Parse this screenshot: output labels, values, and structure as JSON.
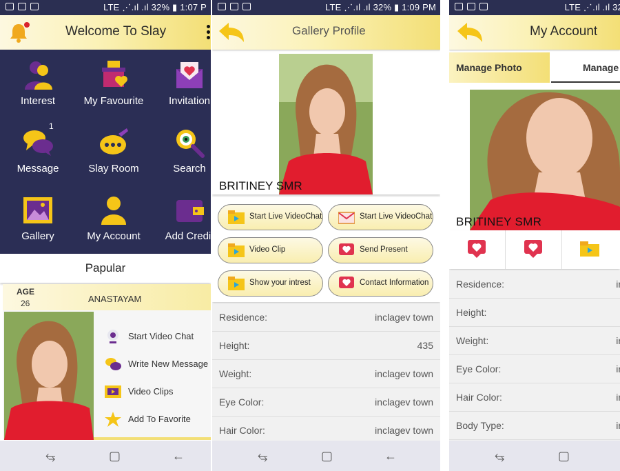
{
  "status": {
    "s1_right": "LTE ⋰.ıl .ıl 32% ▮ 1:07 P",
    "s2_right": "LTE ⋰.ıl .ıl 32% ▮ 1:09 PM",
    "s3_right": "LTE ⋰.ıl .ıl 32"
  },
  "screen1": {
    "title": "Welcome To Slay",
    "grid": [
      {
        "label": "Interest",
        "icon": "interest-icon"
      },
      {
        "label": "My Favourite",
        "icon": "favourite-icon"
      },
      {
        "label": "Invitation",
        "icon": "invitation-icon"
      },
      {
        "label": "Message",
        "icon": "message-icon",
        "badge": "1"
      },
      {
        "label": "Slay Room",
        "icon": "slay-room-icon"
      },
      {
        "label": "Search",
        "icon": "search-icon"
      },
      {
        "label": "Gallery",
        "icon": "gallery-icon"
      },
      {
        "label": "My Account",
        "icon": "account-icon"
      },
      {
        "label": "Add Credit",
        "icon": "wallet-icon"
      }
    ],
    "popular_label": "Papular",
    "card": {
      "age_label": "AGE",
      "age": "26",
      "name": "ANASTAYAM",
      "actions": [
        "Start Video Chat",
        "Write New Message",
        "Video Clips",
        "Add To Favorite"
      ]
    }
  },
  "screen2": {
    "title": "Gallery Profile",
    "name": "BRITINEY SMR",
    "buttons": [
      "Start Live VideoChat",
      "Start Live VideoChat",
      "Video Clip",
      "Send Present",
      "Show your intrest",
      "Contact Information"
    ],
    "info": [
      {
        "label": "Residence:",
        "value": "inclagev town"
      },
      {
        "label": "Height:",
        "value": "435"
      },
      {
        "label": "Weight:",
        "value": "inclagev town"
      },
      {
        "label": "Eye Color:",
        "value": "inclagev town"
      },
      {
        "label": "Hair Color:",
        "value": "inclagev town"
      }
    ]
  },
  "screen3": {
    "title": "My Account",
    "tabs": [
      "Manage Photo",
      "Manage"
    ],
    "name": "BRITINEY SMR",
    "info": [
      {
        "label": "Residence:",
        "value": "ir"
      },
      {
        "label": "Height:",
        "value": ""
      },
      {
        "label": "Weight:",
        "value": "ir"
      },
      {
        "label": "Eye Color:",
        "value": "ir"
      },
      {
        "label": "Hair Color:",
        "value": "ir"
      },
      {
        "label": "Body Type:",
        "value": "ir"
      }
    ]
  },
  "colors": {
    "accent": "#f3df76",
    "dark": "#2b2e55",
    "icon_yellow": "#f5c518",
    "icon_purple": "#6b2d8f",
    "heart_red": "#e0334f"
  }
}
